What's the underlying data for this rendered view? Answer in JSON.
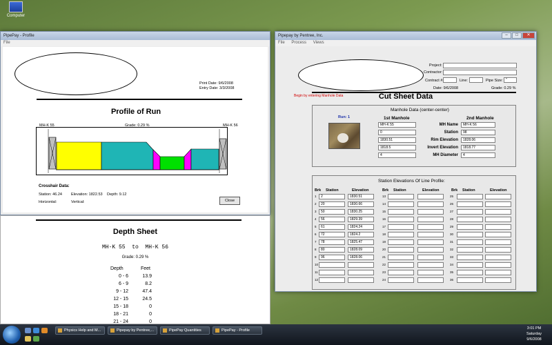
{
  "desktop": {
    "icon_label": "Computer"
  },
  "profile_window": {
    "title": "PipePay - Profile",
    "menu": [
      "File"
    ],
    "print_date": "Print Date: 9/6/2008",
    "entry_date": "Entry Date: 3/3/2008",
    "heading": "Profile of Run",
    "left_mh": "MH-K 55",
    "grade": "Grade: 0.29 %",
    "right_mh": "MH-K 56",
    "crosshair_title": "Crosshair Data:",
    "station": "Station: 46.24",
    "elevation": "Elevation: 1822.53",
    "depth": "Depth: 9.12",
    "horizontal": "Horizontal:",
    "vertical": "Vertical:",
    "close_label": "Close"
  },
  "depth_sheet": {
    "heading": "Depth Sheet",
    "subheading": "MH-K 55  to  MH-K 56",
    "grade": "Grade: 0.29 %",
    "col_depth": "Depth",
    "col_feet": "Feet",
    "rows": [
      {
        "range": "0 - 6",
        "feet": "13.9"
      },
      {
        "range": "6 - 9",
        "feet": "8.2"
      },
      {
        "range": "9 - 12",
        "feet": "47.4"
      },
      {
        "range": "12 - 15",
        "feet": "24.5"
      },
      {
        "range": "15 - 18",
        "feet": "0"
      },
      {
        "range": "18 - 21",
        "feet": "0"
      },
      {
        "range": "21 - 24",
        "feet": "0"
      }
    ]
  },
  "cut_window": {
    "title": "Pipepay by Pentree, Inc.",
    "menu": [
      "File",
      "Process",
      "Views"
    ],
    "project_label": "Project:",
    "contractor_label": "Contractor:",
    "contract_label": "Contract #:",
    "line_label": "Line:",
    "pipe_size_label": "Pipe Size:",
    "pipe_size_value": "\"",
    "date": "Date: 9/6/2008",
    "grade": "Grade: 0.29 %",
    "begin_note": "Begin by entering Manhole Data",
    "heading": "Cut Sheet Data",
    "manhole_title": "Manhole Data (center-center)",
    "run": "Run: 1",
    "first_mh": "1st Manhole",
    "second_mh": "2nd Manhole",
    "fields": [
      {
        "label": "MH Name",
        "v1": "MH-K 55",
        "v2": "MH-K 56"
      },
      {
        "label": "Station",
        "v1": "0",
        "v2": "98"
      },
      {
        "label": "Rim Elevation",
        "v1": "1830.51",
        "v2": "1828.06"
      },
      {
        "label": "Invert Elevation",
        "v1": "1818.5",
        "v2": "1818.77"
      },
      {
        "label": "MH Diameter",
        "v1": "4",
        "v2": "4"
      }
    ],
    "station_title": "Station Elevations Of Line Profile:",
    "col_brk": "Brk",
    "col_station": "Station",
    "col_elevation": "Elevation",
    "rows": [
      {
        "brk": "1",
        "station": "2",
        "elevation": "1830.51"
      },
      {
        "brk": "2",
        "station": "20",
        "elevation": "1830.66"
      },
      {
        "brk": "3",
        "station": "50",
        "elevation": "1830.25"
      },
      {
        "brk": "4",
        "station": "56",
        "elevation": "1829.39"
      },
      {
        "brk": "5",
        "station": "61",
        "elevation": "1824.24"
      },
      {
        "brk": "6",
        "station": "72",
        "elevation": "1824.2"
      },
      {
        "brk": "7",
        "station": "78",
        "elevation": "1825.47"
      },
      {
        "brk": "8",
        "station": "80",
        "elevation": "1828.09"
      },
      {
        "brk": "9",
        "station": "96",
        "elevation": "1828.06"
      },
      {
        "brk": "10",
        "station": "",
        "elevation": ""
      },
      {
        "brk": "11",
        "station": "",
        "elevation": ""
      },
      {
        "brk": "12",
        "station": "",
        "elevation": ""
      }
    ],
    "rows2": [
      "13",
      "14",
      "15",
      "16",
      "17",
      "18",
      "19",
      "20",
      "21",
      "22",
      "23",
      "24"
    ],
    "rows3": [
      "25",
      "26",
      "27",
      "28",
      "29",
      "30",
      "31",
      "32",
      "33",
      "34",
      "35",
      "36"
    ]
  },
  "taskbar": {
    "buttons": [
      "Physics Help and M...",
      "Pipepay by Pentree,...",
      "PipePay Quantities",
      "PipePay - Profile"
    ],
    "time": "3:01 PM",
    "day": "Saturday",
    "date": "9/6/2008"
  },
  "colors": {
    "yellow": "#ffff00",
    "cyan": "#1fb5b5",
    "magenta": "#ff00ff",
    "green": "#00e000"
  }
}
